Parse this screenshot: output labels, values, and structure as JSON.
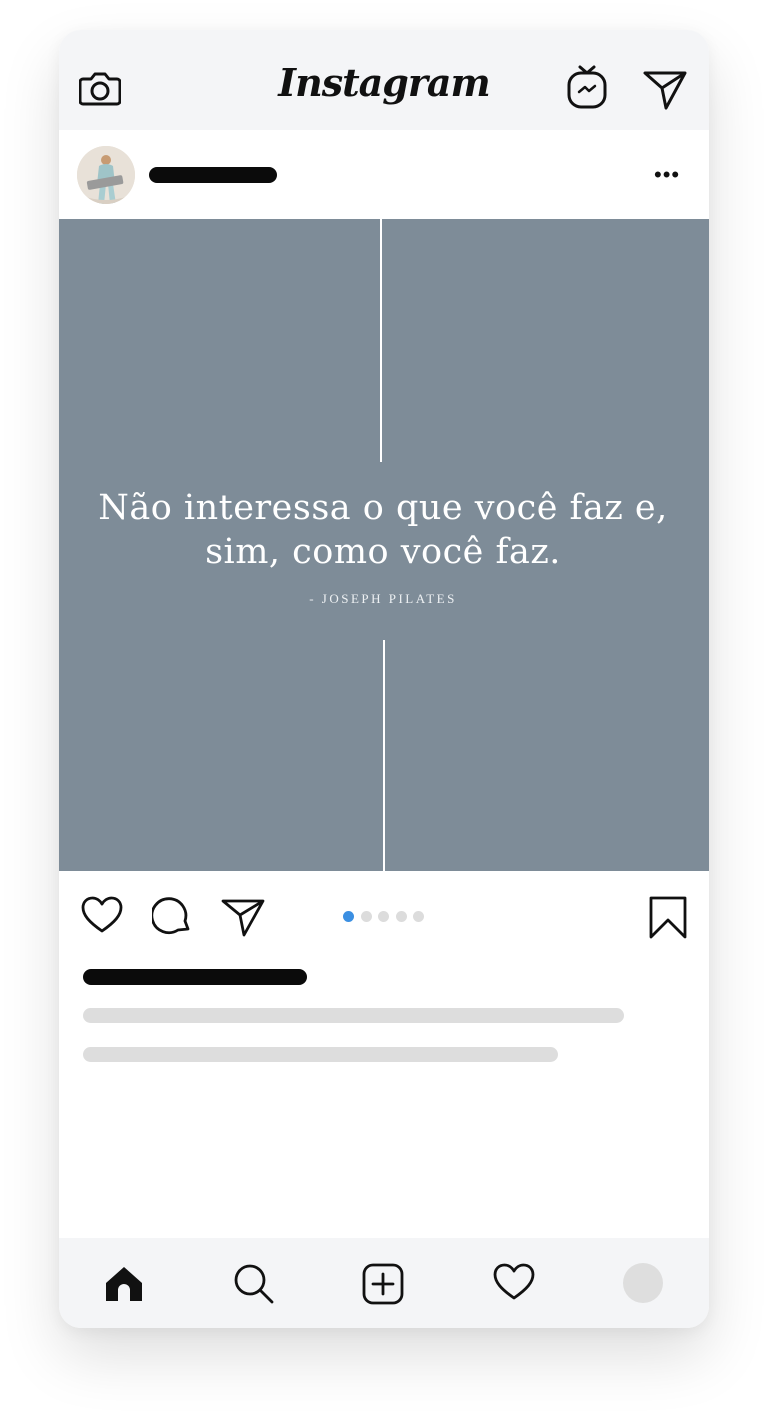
{
  "app": {
    "brand": "Instagram"
  },
  "post": {
    "quote": "Não interessa o que você faz e, sim, como você faz.",
    "attribution": "- JOSEPH PILATES",
    "carousel": {
      "total": 5,
      "active_index": 0
    }
  },
  "colors": {
    "image_background": "#7e8c98",
    "active_dot": "#3b8fe2",
    "inactive_dot": "#dcdcdc",
    "bar_background": "#f4f5f7"
  },
  "icons": {
    "top_left": "camera-icon",
    "top_right": [
      "igtv-icon",
      "direct-message-icon"
    ],
    "actions": [
      "like-icon",
      "comment-icon",
      "share-icon",
      "save-icon"
    ],
    "tabs": [
      "home-icon",
      "search-icon",
      "new-post-icon",
      "activity-icon",
      "profile-avatar"
    ]
  }
}
